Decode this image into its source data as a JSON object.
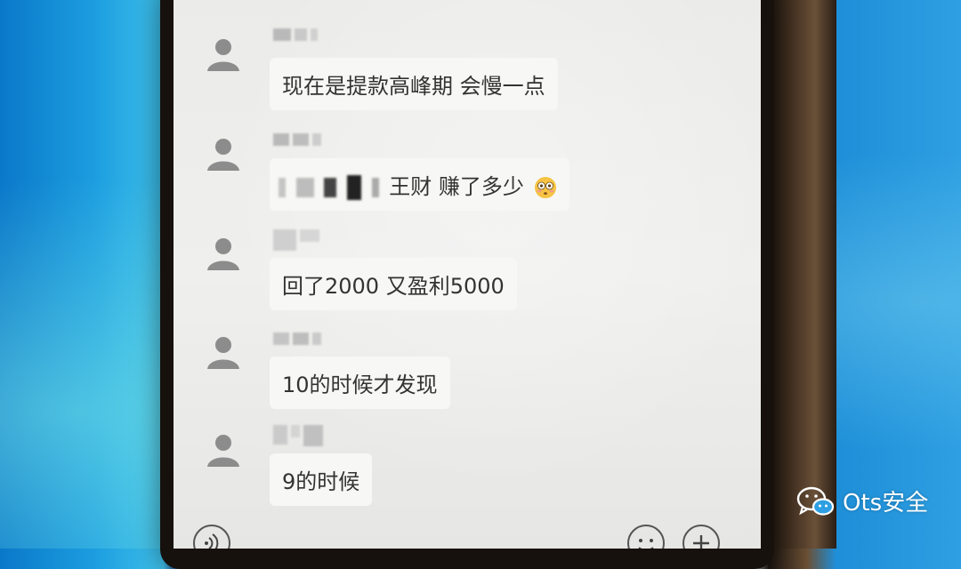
{
  "messages": [
    {
      "text": "现在是提款高峰期 会慢一点"
    },
    {
      "text_suffix": "王财  赚了多少",
      "emoji": "flushed-face"
    },
    {
      "text": "回了2000 又盈利5000"
    },
    {
      "text": "10的时候才发现"
    },
    {
      "text": "9的时候"
    }
  ],
  "input_bar": {
    "voice_icon": "voice-icon",
    "emoji_icon": "emoji-icon",
    "plus_icon": "plus-icon"
  },
  "watermark": {
    "text": "Ots安全",
    "icon": "wechat-icon"
  },
  "colors": {
    "screen": "#efefed",
    "bubble": "#f7f7f5",
    "text": "#333333",
    "watermark": "#ffffff"
  }
}
